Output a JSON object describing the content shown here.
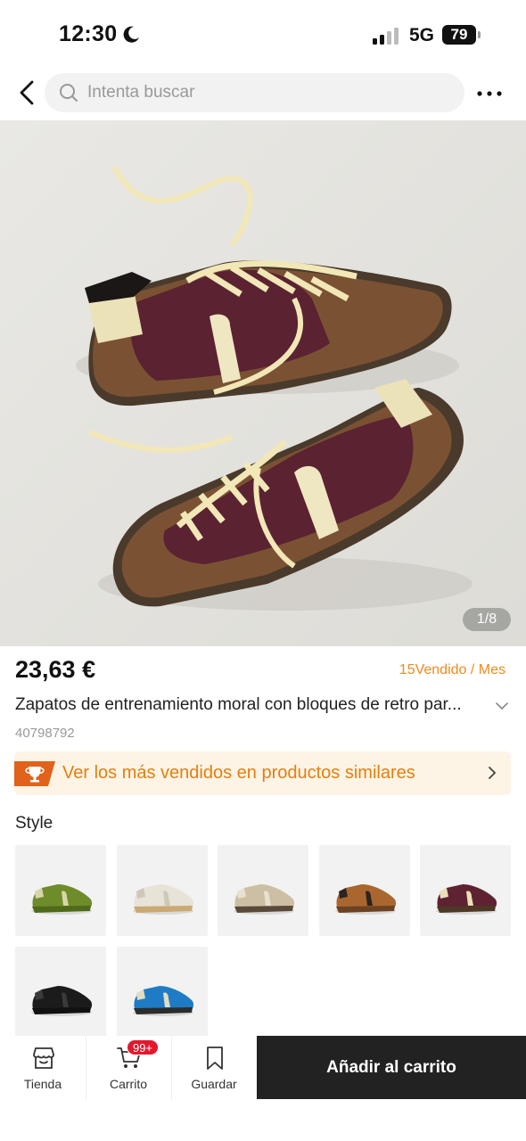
{
  "status_bar": {
    "time": "12:30",
    "network": "5G",
    "battery": "79"
  },
  "search": {
    "placeholder": "Intenta buscar"
  },
  "gallery": {
    "counter": "1/8"
  },
  "product": {
    "price": "23,63 €",
    "sold": "15Vendido / Mes",
    "title": "Zapatos de entrenamiento moral con bloques de retro par...",
    "id": "40798792"
  },
  "banner": {
    "text": "Ver los más vendidos en productos similares"
  },
  "styles": {
    "label": "Style",
    "items": [
      {
        "name": "green",
        "upper": "#6e8c2a",
        "accent": "#d8d6a8",
        "sole": "#4f6a1c"
      },
      {
        "name": "white",
        "upper": "#e8e3d8",
        "accent": "#cfc8b6",
        "sole": "#c9a974"
      },
      {
        "name": "beige",
        "upper": "#cdbfa3",
        "accent": "#e9e1cf",
        "sole": "#5a4a3a"
      },
      {
        "name": "tan",
        "upper": "#a9672f",
        "accent": "#2b2420",
        "sole": "#6b4322"
      },
      {
        "name": "burgundy",
        "upper": "#5e2233",
        "accent": "#e9dfb8",
        "sole": "#4d3826"
      },
      {
        "name": "black",
        "upper": "#1b1b1b",
        "accent": "#3a3a3a",
        "sole": "#111111"
      },
      {
        "name": "blue",
        "upper": "#1f7cc4",
        "accent": "#e2ddc5",
        "sole": "#2c2c2c"
      }
    ]
  },
  "bottom_nav": {
    "store": "Tienda",
    "cart": "Carrito",
    "cart_badge": "99+",
    "save": "Guardar",
    "add_to_cart": "Añadir al carrito"
  },
  "colors": {
    "accent": "#f08a1c",
    "badge": "#e3182d",
    "cta": "#222222"
  }
}
